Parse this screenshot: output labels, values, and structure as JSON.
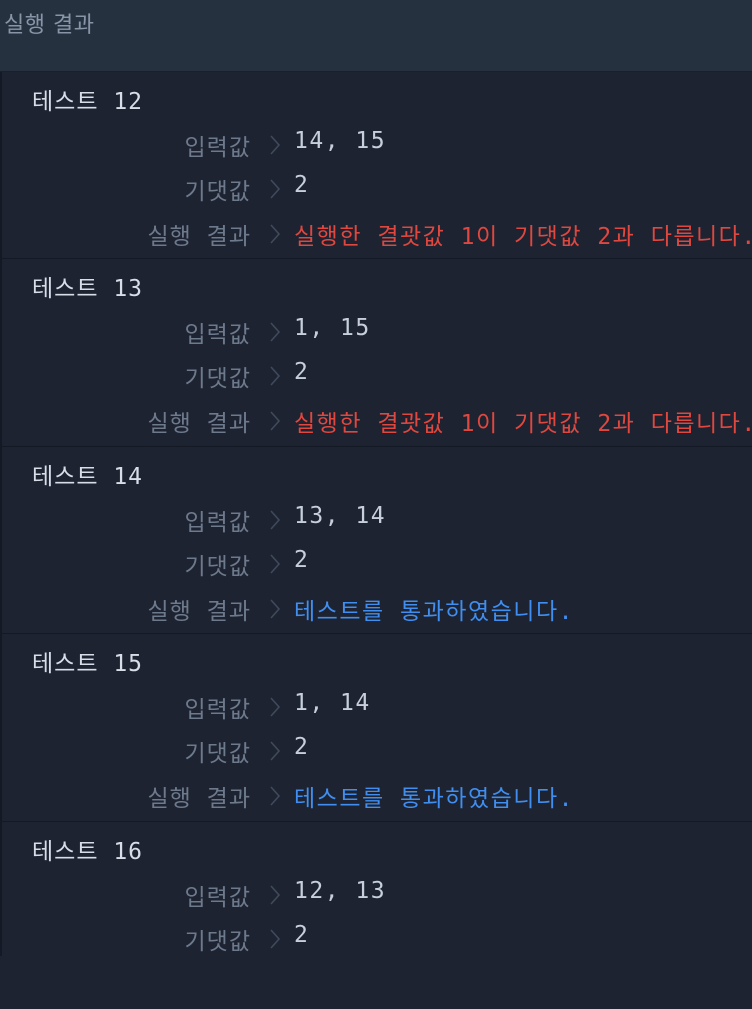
{
  "panel": {
    "title": "실행 결과"
  },
  "labels": {
    "input": "입력값",
    "expected": "기댓값",
    "result": "실행 결과"
  },
  "colors": {
    "fail": "#e0473f",
    "pass": "#3f8ef0",
    "background": "#1d2331",
    "header": "#263140"
  },
  "icons": {
    "separator": "chevron-right-icon"
  },
  "tests": [
    {
      "title": "테스트 12",
      "input": "14, 15",
      "expected": "2",
      "result": "실행한 결괏값 1이 기댓값 2과 다릅니다.",
      "status": "fail"
    },
    {
      "title": "테스트 13",
      "input": "1, 15",
      "expected": "2",
      "result": "실행한 결괏값 1이 기댓값 2과 다릅니다.",
      "status": "fail"
    },
    {
      "title": "테스트 14",
      "input": "13, 14",
      "expected": "2",
      "result": "테스트를 통과하였습니다.",
      "status": "pass"
    },
    {
      "title": "테스트 15",
      "input": "1, 14",
      "expected": "2",
      "result": "테스트를 통과하였습니다.",
      "status": "pass"
    },
    {
      "title": "테스트 16",
      "input": "12, 13",
      "expected": "2"
    }
  ]
}
